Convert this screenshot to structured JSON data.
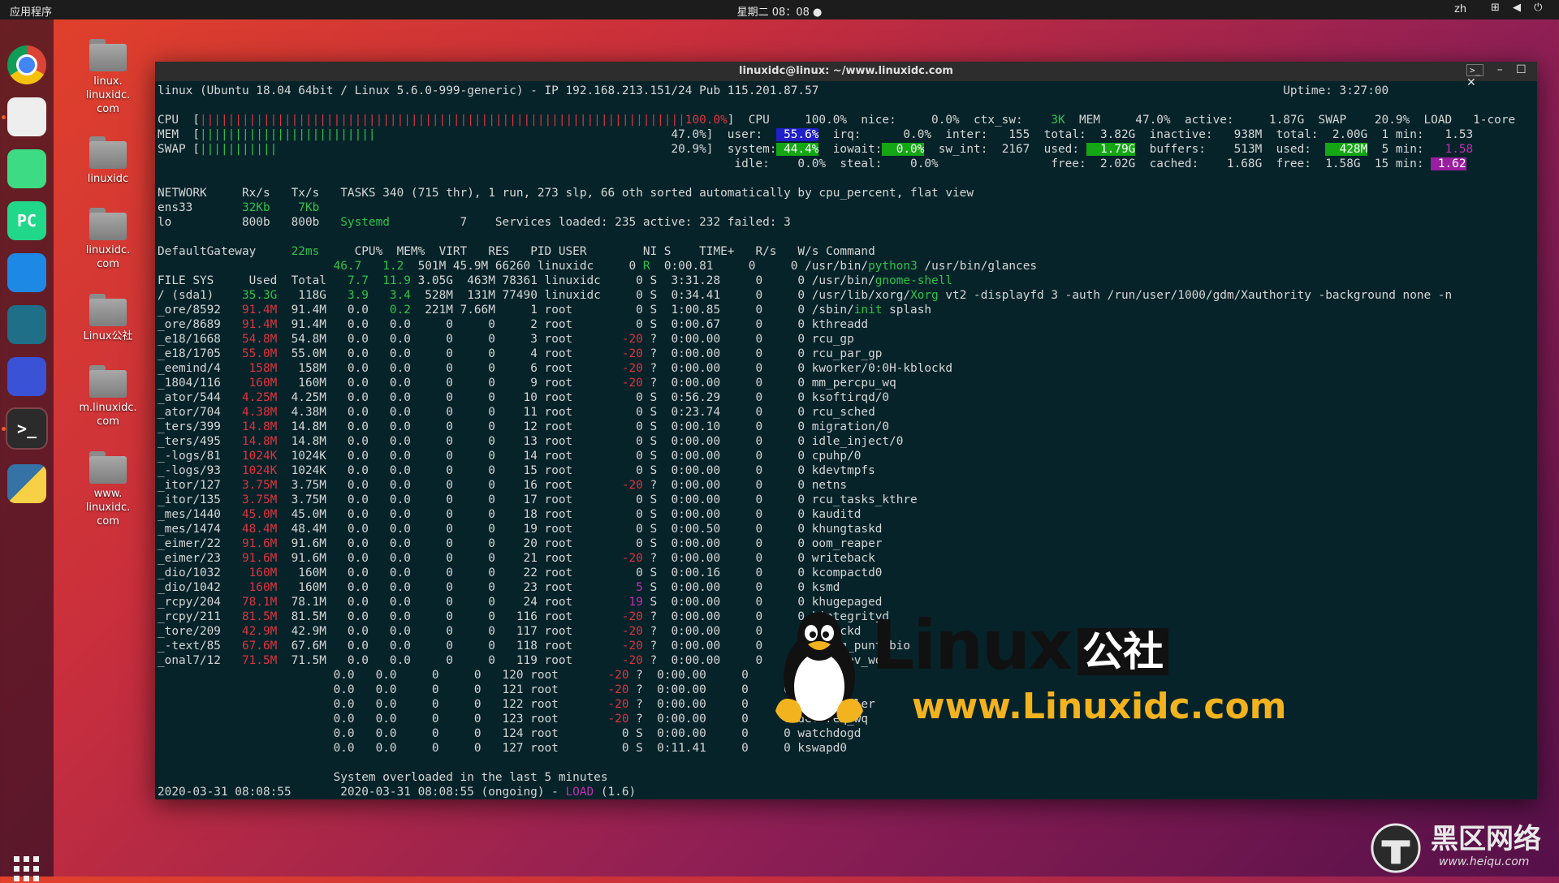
{
  "topbar": {
    "apps": "应用程序",
    "clock": "星期二 08：08 ●",
    "lang": "zh",
    "tray": "⊞ ◀ ⏻"
  },
  "dock": {
    "items": [
      {
        "name": "chrome-icon",
        "label": "",
        "color": "#dd4b39"
      },
      {
        "name": "files-icon",
        "label": "",
        "color": "#eeeeee"
      },
      {
        "name": "android-studio-icon",
        "label": "",
        "color": "#3ddc84"
      },
      {
        "name": "pycharm-icon",
        "label": "PC",
        "color": "#21d789"
      },
      {
        "name": "system-monitor-icon",
        "label": "",
        "color": "#1e88e5"
      },
      {
        "name": "sublime-icon",
        "label": "",
        "color": "#1e6f87"
      },
      {
        "name": "screenshot-icon",
        "label": "",
        "color": "#3a52d6"
      },
      {
        "name": "terminal-icon",
        "label": ">_",
        "color": "#2b2b2b"
      },
      {
        "name": "python-icon",
        "label": "",
        "color": "#3572a5"
      }
    ]
  },
  "desktop": {
    "icons": [
      {
        "label": "linux.\nlinuxidc.\ncom"
      },
      {
        "label": "linuxidc"
      },
      {
        "label": "linuxidc.\ncom"
      },
      {
        "label": "Linux公社"
      },
      {
        "label": "m.linuxidc.\ncom"
      },
      {
        "label": "www.\nlinuxidc.\ncom"
      }
    ]
  },
  "window": {
    "title": "linuxidc@linux: ~/www.linuxidc.com",
    "btn_min": "–",
    "btn_max": "☐",
    "btn_close": "✕"
  },
  "terminal": {
    "lines": [
      [
        [
          "linux (Ubuntu 18.04 64bit / Linux 5.6.0-999-generic) - IP 192.168.213.151/24 Pub 115.201.87.57                                                                  Uptime: 3:27:00",
          ""
        ]
      ],
      [
        [
          "",
          ""
        ]
      ],
      [
        [
          "CPU  [",
          ""
        ],
        [
          "|||||||||||||||||||||||||||||||||||||||||||||||||||||||||||||||||||||100.0%",
          "r"
        ],
        [
          "]  CPU     100.0%  nice:     0.0%  ctx_sw:    ",
          ""
        ],
        [
          "3K",
          "g"
        ],
        [
          "  MEM     47.0%  active:     1.87G  SWAP    20.9%  LOAD   1-core",
          ""
        ]
      ],
      [
        [
          "MEM  [",
          ""
        ],
        [
          "|||||||||||||||||||||||||",
          "g"
        ],
        [
          "                                          47.0%]  user:  ",
          ""
        ],
        [
          " 55.6%",
          "bb"
        ],
        [
          "  irq:      0.0%  inter:   155  total:  3.82G  inactive:   938M  total:  2.00G  1 min:   1.53",
          ""
        ]
      ],
      [
        [
          "SWAP [",
          ""
        ],
        [
          "|||||||||||",
          "g"
        ],
        [
          "                                                        20.9%]  system:",
          ""
        ],
        [
          " 44.4%",
          "bg"
        ],
        [
          "  iowait:",
          ""
        ],
        [
          "  0.0%",
          "bg"
        ],
        [
          "  sw_int:  2167  used: ",
          ""
        ],
        [
          "  1.79G",
          "bg"
        ],
        [
          "  buffers:    513M  used:  ",
          ""
        ],
        [
          "  428M",
          "bg"
        ],
        [
          "  5 min:   ",
          ""
        ],
        [
          "1.58",
          "m"
        ]
      ],
      [
        [
          "                                                                                  idle:    0.0%  steal:    0.0%                free:  2.02G  cached:    1.68G  free:  1.58G  15 min: ",
          ""
        ],
        [
          " 1.62",
          "bm"
        ]
      ],
      [
        [
          "",
          ""
        ]
      ],
      [
        [
          "NETWORK     Rx/s   Tx/s   TASKS 340 (715 thr), 1 run, 273 slp, 66 oth sorted automatically by cpu_percent, flat view",
          ""
        ]
      ],
      [
        [
          "ens33       ",
          ""
        ],
        [
          "32Kb    7Kb",
          "g"
        ]
      ],
      [
        [
          "lo          800b   800b   ",
          ""
        ],
        [
          "Systemd",
          "g"
        ],
        [
          "          7    Services loaded: 235 active: 232 failed: 3",
          ""
        ]
      ],
      [
        [
          "",
          ""
        ]
      ],
      [
        [
          "DefaultGateway     ",
          ""
        ],
        [
          "22ms",
          "g"
        ],
        [
          "     CPU%  MEM%  VIRT   RES   PID USER        NI S    TIME+   R/s   W/s Command",
          ""
        ]
      ],
      [
        [
          "                         ",
          ""
        ],
        [
          "46.7   1.2",
          "g"
        ],
        [
          "  501M 45.9M 66260 linuxidc     0 ",
          ""
        ],
        [
          "R",
          "g"
        ],
        [
          "  0:00.81     0     0 /usr/bin/",
          ""
        ],
        [
          "python3",
          "g"
        ],
        [
          " /usr/bin/glances",
          ""
        ]
      ],
      [
        [
          "FILE SYS     Used  Total   ",
          ""
        ],
        [
          "7.7  11.9",
          "g"
        ],
        [
          " 3.05G  463M 78361 linuxidc     0 S  3:31.28     0     0 /usr/bin/",
          ""
        ],
        [
          "gnome-shell",
          "g"
        ]
      ],
      [
        [
          "/ (sda1)    ",
          ""
        ],
        [
          "35.3G",
          "g"
        ],
        [
          "   118G   ",
          ""
        ],
        [
          "3.9   3.4",
          "g"
        ],
        [
          "  528M  131M 77490 linuxidc     0 S  0:34.41     0     0 /usr/lib/xorg/",
          ""
        ],
        [
          "Xorg",
          "g"
        ],
        [
          " vt2 -displayfd 3 -auth /run/user/1000/gdm/Xauthority -background none -n",
          ""
        ]
      ],
      [
        [
          "_ore/8592   ",
          ""
        ],
        [
          "91.4M",
          "r"
        ],
        [
          "  91.4M   0.0   ",
          ""
        ],
        [
          "0.2",
          "g"
        ],
        [
          "  221M 7.66M     1 root         0 S  1:00.85     0     0 /sbin/",
          ""
        ],
        [
          "init",
          "g"
        ],
        [
          " splash",
          ""
        ]
      ],
      [
        [
          "_ore/8689   ",
          ""
        ],
        [
          "91.4M",
          "r"
        ],
        [
          "  91.4M   0.0   0.0     0     0     2 root         0 S  0:00.67     0     0 kthreadd",
          ""
        ]
      ],
      [
        [
          "_e18/1668   ",
          ""
        ],
        [
          "54.8M",
          "r"
        ],
        [
          "  54.8M   0.0   0.0     0     0     3 root       ",
          ""
        ],
        [
          "-20",
          "r"
        ],
        [
          " ?  0:00.00     0     0 rcu_gp",
          ""
        ]
      ],
      [
        [
          "_e18/1705   ",
          ""
        ],
        [
          "55.0M",
          "r"
        ],
        [
          "  55.0M   0.0   0.0     0     0     4 root       ",
          ""
        ],
        [
          "-20",
          "r"
        ],
        [
          " ?  0:00.00     0     0 rcu_par_gp",
          ""
        ]
      ],
      [
        [
          "_eemind/4    ",
          ""
        ],
        [
          "158M",
          "r"
        ],
        [
          "   158M   0.0   0.0     0     0     6 root       ",
          ""
        ],
        [
          "-20",
          "r"
        ],
        [
          " ?  0:00.00     0     0 kworker/0:0H-kblockd",
          ""
        ]
      ],
      [
        [
          "_1804/116    ",
          ""
        ],
        [
          "160M",
          "r"
        ],
        [
          "   160M   0.0   0.0     0     0     9 root       ",
          ""
        ],
        [
          "-20",
          "r"
        ],
        [
          " ?  0:00.00     0     0 mm_percpu_wq",
          ""
        ]
      ],
      [
        [
          "_ator/544   ",
          ""
        ],
        [
          "4.25M",
          "r"
        ],
        [
          "  4.25M   0.0   0.0     0     0    10 root         0 S  0:56.29     0     0 ksoftirqd/0",
          ""
        ]
      ],
      [
        [
          "_ator/704   ",
          ""
        ],
        [
          "4.38M",
          "r"
        ],
        [
          "  4.38M   0.0   0.0     0     0    11 root         0 S  0:23.74     0     0 rcu_sched",
          ""
        ]
      ],
      [
        [
          "_ters/399   ",
          ""
        ],
        [
          "14.8M",
          "r"
        ],
        [
          "  14.8M   0.0   0.0     0     0    12 root         0 S  0:00.10     0     0 migration/0",
          ""
        ]
      ],
      [
        [
          "_ters/495   ",
          ""
        ],
        [
          "14.8M",
          "r"
        ],
        [
          "  14.8M   0.0   0.0     0     0    13 root         0 S  0:00.00     0     0 idle_inject/0",
          ""
        ]
      ],
      [
        [
          "_-logs/81   ",
          ""
        ],
        [
          "1024K",
          "r"
        ],
        [
          "  1024K   0.0   0.0     0     0    14 root         0 S  0:00.00     0     0 cpuhp/0",
          ""
        ]
      ],
      [
        [
          "_-logs/93   ",
          ""
        ],
        [
          "1024K",
          "r"
        ],
        [
          "  1024K   0.0   0.0     0     0    15 root         0 S  0:00.00     0     0 kdevtmpfs",
          ""
        ]
      ],
      [
        [
          "_itor/127   ",
          ""
        ],
        [
          "3.75M",
          "r"
        ],
        [
          "  3.75M   0.0   0.0     0     0    16 root       ",
          ""
        ],
        [
          "-20",
          "r"
        ],
        [
          " ?  0:00.00     0     0 netns",
          ""
        ]
      ],
      [
        [
          "_itor/135   ",
          ""
        ],
        [
          "3.75M",
          "r"
        ],
        [
          "  3.75M   0.0   0.0     0     0    17 root         0 S  0:00.00     0     0 rcu_tasks_kthre",
          ""
        ]
      ],
      [
        [
          "_mes/1440   ",
          ""
        ],
        [
          "45.0M",
          "r"
        ],
        [
          "  45.0M   0.0   0.0     0     0    18 root         0 S  0:00.00     0     0 kauditd",
          ""
        ]
      ],
      [
        [
          "_mes/1474   ",
          ""
        ],
        [
          "48.4M",
          "r"
        ],
        [
          "  48.4M   0.0   0.0     0     0    19 root         0 S  0:00.50     0     0 khungtaskd",
          ""
        ]
      ],
      [
        [
          "_eimer/22   ",
          ""
        ],
        [
          "91.6M",
          "r"
        ],
        [
          "  91.6M   0.0   0.0     0     0    20 root         0 S  0:00.00     0     0 oom_reaper",
          ""
        ]
      ],
      [
        [
          "_eimer/23   ",
          ""
        ],
        [
          "91.6M",
          "r"
        ],
        [
          "  91.6M   0.0   0.0     0     0    21 root       ",
          ""
        ],
        [
          "-20",
          "r"
        ],
        [
          " ?  0:00.00     0     0 writeback",
          ""
        ]
      ],
      [
        [
          "_dio/1032    ",
          ""
        ],
        [
          "160M",
          "r"
        ],
        [
          "   160M   0.0   0.0     0     0    22 root         0 S  0:00.16     0     0 kcompactd0",
          ""
        ]
      ],
      [
        [
          "_dio/1042    ",
          ""
        ],
        [
          "160M",
          "r"
        ],
        [
          "   160M   0.0   0.0     0     0    23 root         ",
          ""
        ],
        [
          "5",
          "m"
        ],
        [
          " S  0:00.00     0     0 ksmd",
          ""
        ]
      ],
      [
        [
          "_rcpy/204   ",
          ""
        ],
        [
          "78.1M",
          "r"
        ],
        [
          "  78.1M   0.0   0.0     0     0    24 root        ",
          ""
        ],
        [
          "19",
          "m"
        ],
        [
          " S  0:00.00     0     0 khugepaged",
          ""
        ]
      ],
      [
        [
          "_rcpy/211   ",
          ""
        ],
        [
          "81.5M",
          "r"
        ],
        [
          "  81.5M   0.0   0.0     0     0   116 root       ",
          ""
        ],
        [
          "-20",
          "r"
        ],
        [
          " ?  0:00.00     0     0 kintegrityd",
          ""
        ]
      ],
      [
        [
          "_tore/209   ",
          ""
        ],
        [
          "42.9M",
          "r"
        ],
        [
          "  42.9M   0.0   0.0     0     0   117 root       ",
          ""
        ],
        [
          "-20",
          "r"
        ],
        [
          " ?  0:00.00     0     0 kblockd",
          ""
        ]
      ],
      [
        [
          "_-text/85   ",
          ""
        ],
        [
          "67.6M",
          "r"
        ],
        [
          "  67.6M   0.0   0.0     0     0   118 root       ",
          ""
        ],
        [
          "-20",
          "r"
        ],
        [
          " ?  0:00.00     0     0 blkcg_punt_bio",
          ""
        ]
      ],
      [
        [
          "_onal7/12   ",
          ""
        ],
        [
          "71.5M",
          "r"
        ],
        [
          "  71.5M   0.0   0.0     0     0   119 root       ",
          ""
        ],
        [
          "-20",
          "r"
        ],
        [
          " ?  0:00.00     0     0 tpm_dev_wq",
          ""
        ]
      ],
      [
        [
          "                         0.0   0.0     0     0   120 root       ",
          ""
        ],
        [
          "-20",
          "r"
        ],
        [
          " ?  0:00.00     0     0 ata_sff",
          ""
        ]
      ],
      [
        [
          "                         0.0   0.0     0     0   121 root       ",
          ""
        ],
        [
          "-20",
          "r"
        ],
        [
          " ?  0:00.00     0     0 md",
          ""
        ]
      ],
      [
        [
          "                         0.0   0.0     0     0   122 root       ",
          ""
        ],
        [
          "-20",
          "r"
        ],
        [
          " ?  0:00.00     0     0 edac-poller",
          ""
        ]
      ],
      [
        [
          "                         0.0   0.0     0     0   123 root       ",
          ""
        ],
        [
          "-20",
          "r"
        ],
        [
          " ?  0:00.00     0     0 devfreq_wq",
          ""
        ]
      ],
      [
        [
          "                         0.0   0.0     0     0   124 root         0 S  0:00.00     0     0 watchdogd",
          ""
        ]
      ],
      [
        [
          "                         0.0   0.0     0     0   127 root         0 S  0:11.41     0     0 kswapd0",
          ""
        ]
      ],
      [
        [
          "",
          ""
        ]
      ],
      [
        [
          "                         System overloaded in the last 5 minutes",
          ""
        ]
      ],
      [
        [
          "2020-03-31 08:08:55       2020-03-31 08:08:55 (ongoing) - ",
          ""
        ],
        [
          "LOAD",
          "m"
        ],
        [
          " (1.6)",
          ""
        ]
      ]
    ]
  },
  "watermark": {
    "brand": "Linux",
    "brand_cn": "公社",
    "url": "www.Linuxidc.com"
  },
  "corner_logo": {
    "cn": "黑区网络",
    "url": "www.heiqu.com"
  }
}
